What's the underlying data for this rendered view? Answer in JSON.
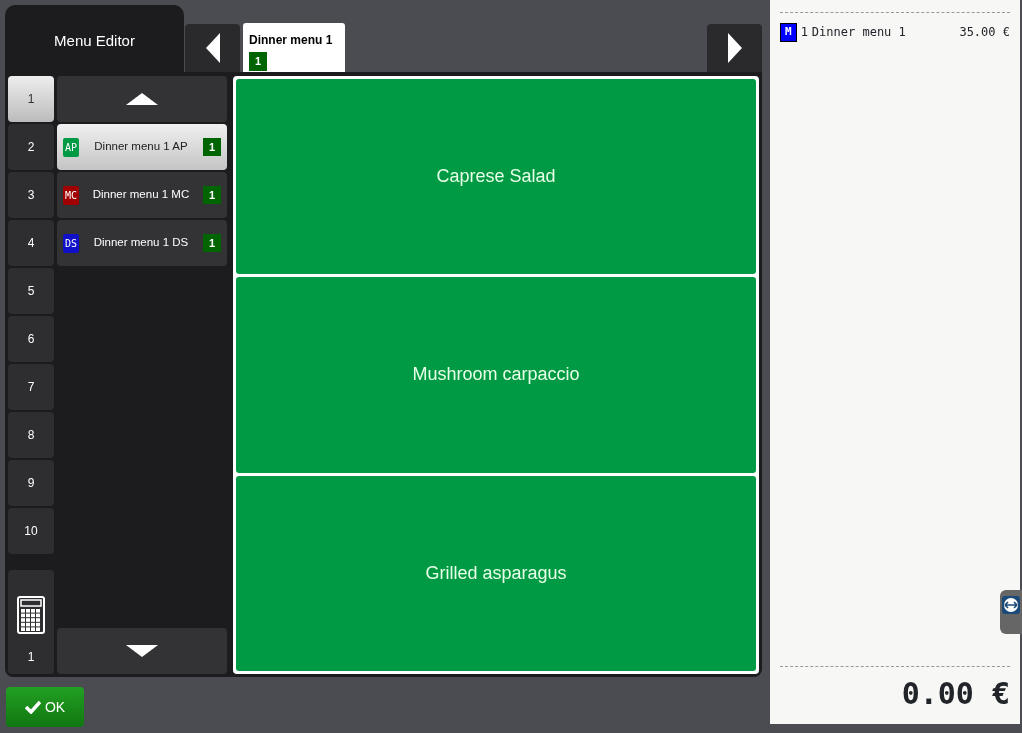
{
  "header": {
    "title": "Menu Editor"
  },
  "tabs": [
    {
      "label": "Dinner menu 1",
      "count": "1",
      "selected": true
    }
  ],
  "number_buttons": [
    {
      "label": "1",
      "selected": true
    },
    {
      "label": "2",
      "selected": false
    },
    {
      "label": "3",
      "selected": false
    },
    {
      "label": "4",
      "selected": false
    },
    {
      "label": "5",
      "selected": false
    },
    {
      "label": "6",
      "selected": false
    },
    {
      "label": "7",
      "selected": false
    },
    {
      "label": "8",
      "selected": false
    },
    {
      "label": "9",
      "selected": false
    },
    {
      "label": "10",
      "selected": false
    }
  ],
  "calculator": {
    "value": "1"
  },
  "menu_list": [
    {
      "code": "AP",
      "color": "#009a44",
      "label": "Dinner menu 1 AP",
      "count": "1",
      "selected": true
    },
    {
      "code": "MC",
      "color": "#a00000",
      "label": "Dinner menu 1 MC",
      "count": "1",
      "selected": false
    },
    {
      "code": "DS",
      "color": "#1010c8",
      "label": "Dinner menu 1 DS",
      "count": "1",
      "selected": false
    }
  ],
  "items": [
    {
      "label": "Caprese Salad"
    },
    {
      "label": "Mushroom carpaccio"
    },
    {
      "label": "Grilled asparagus"
    }
  ],
  "ok_button": {
    "label": "OK"
  },
  "receipt": {
    "lines": [
      {
        "code": "M",
        "qty": "1",
        "name": "Dinner menu 1",
        "price": "35.00 €"
      }
    ],
    "total": "0.00 €"
  }
}
